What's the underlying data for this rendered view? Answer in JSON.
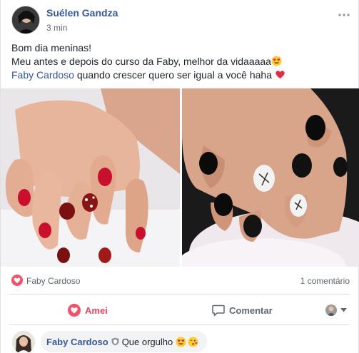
{
  "post": {
    "author": "Suélen Gandza",
    "time": "3 min",
    "more_icon": "ellipsis-icon",
    "text_line1": "Bom dia meninas!",
    "text_line2": "Meu antes e depois do curso da Faby, melhor da vidaaaaa",
    "text_line3_mention": "Faby Cardoso",
    "text_line3_rest": " quando crescer quero ser igual a você haha ",
    "photos": [
      "nails-before-photo",
      "nails-after-photo"
    ]
  },
  "reactions": {
    "icon": "love-reaction-icon",
    "names": "Faby Cardoso",
    "comment_count": "1 comentário"
  },
  "actions": {
    "like_label": "Amei",
    "comment_label": "Comentar"
  },
  "comment": {
    "author": "Faby Cardoso",
    "text": "Que orgulho"
  },
  "colors": {
    "link": "#365899",
    "love": "#e0475e",
    "muted": "#616770",
    "bubble": "#f2f3f5"
  }
}
